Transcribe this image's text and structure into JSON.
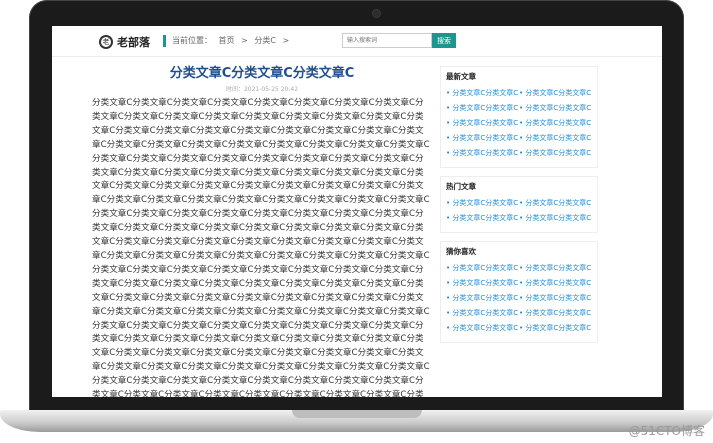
{
  "header": {
    "logo_mark": "老",
    "logo_text": "老部落",
    "breadcrumb": [
      "当前位置：",
      "首页",
      ">",
      "分类C",
      ">"
    ],
    "search_placeholder": "输入搜索词",
    "search_button": "搜索"
  },
  "article": {
    "title": "分类文章C分类文章C分类文章C",
    "meta": "时间：2021-05-25 20:42",
    "body_unit": "分类文章C",
    "body_repeat": 186
  },
  "sidebar": {
    "latest": {
      "title": "最新文章",
      "items": [
        "分类文章C分类文章C",
        "分类文章C分类文章C",
        "分类文章C分类文章C",
        "分类文章C分类文章C",
        "分类文章C分类文章C",
        "分类文章C分类文章C",
        "分类文章C分类文章C",
        "分类文章C分类文章C",
        "分类文章C分类文章C",
        "分类文章C分类文章C"
      ]
    },
    "hot": {
      "title": "热门文章",
      "items": [
        "分类文章C分类文章C",
        "分类文章C分类文章C",
        "分类文章C分类文章C",
        "分类文章C分类文章C"
      ]
    },
    "guess": {
      "title": "猜你喜欢",
      "items": [
        "分类文章C分类文章C",
        "分类文章C分类文章C",
        "分类文章C分类文章C",
        "分类文章C分类文章C",
        "分类文章C分类文章C",
        "分类文章C分类文章C",
        "分类文章C分类文章C",
        "分类文章C分类文章C",
        "分类文章C分类文章C",
        "分类文章C分类文章C"
      ]
    }
  },
  "watermark": "@51CTO博客",
  "colors": {
    "accent": "#20958f",
    "title_blue": "#1f4f8f",
    "link_blue": "#1e8ad6",
    "frame": "#1b1b1b"
  }
}
